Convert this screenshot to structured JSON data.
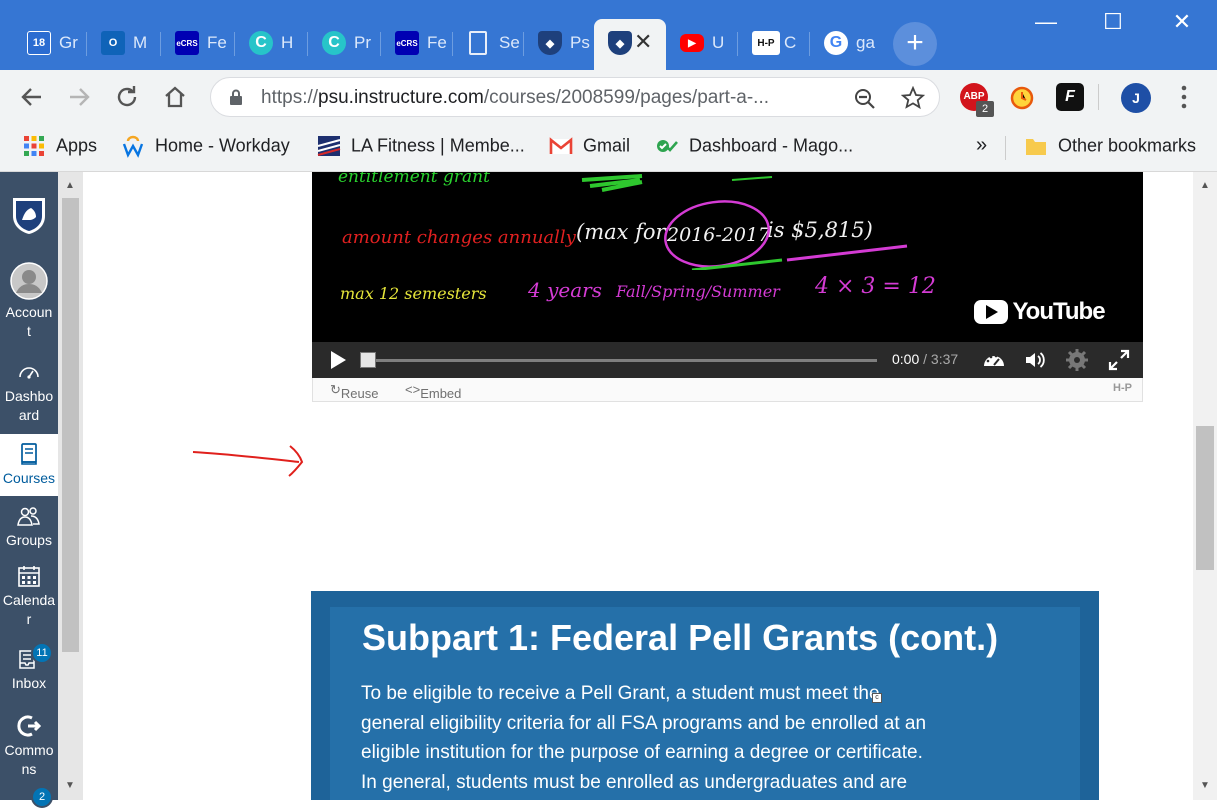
{
  "browser": {
    "tabs": [
      {
        "title": "Gr",
        "favicon": "calendar-18-icon",
        "badge": "18"
      },
      {
        "title": "M",
        "favicon": "outlook-icon"
      },
      {
        "title": "Fe",
        "favicon": "ecrs-icon",
        "badge": "eCRS"
      },
      {
        "title": "H",
        "favicon": "circle-c-icon"
      },
      {
        "title": "Pr",
        "favicon": "circle-c-icon"
      },
      {
        "title": "Fe",
        "favicon": "ecrs-icon",
        "badge": "eCRS"
      },
      {
        "title": "Se",
        "favicon": "document-icon"
      },
      {
        "title": "Ps",
        "favicon": "penn-state-shield-icon"
      },
      {
        "title": "",
        "favicon": "penn-state-shield-icon",
        "active": true
      },
      {
        "title": "U",
        "favicon": "youtube-icon"
      },
      {
        "title": "C",
        "favicon": "h5p-icon",
        "badge": "H-P"
      },
      {
        "title": "ga",
        "favicon": "google-icon"
      }
    ],
    "new_tab": "+",
    "window_controls": {
      "minimize": "—",
      "maximize": "☐",
      "close": "✕"
    },
    "url": {
      "scheme": "https://",
      "host": "psu.instructure.com",
      "path": "/courses/2008599/pages/part-a-..."
    },
    "extensions": {
      "abp_label": "ABP",
      "abp_count": "2",
      "profile_initial": "J"
    },
    "bookmarks": [
      {
        "label": "Apps",
        "icon": "apps-grid-icon"
      },
      {
        "label": "Home - Workday",
        "icon": "workday-icon"
      },
      {
        "label": "LA Fitness | Membe...",
        "icon": "la-fitness-icon"
      },
      {
        "label": "Gmail",
        "icon": "gmail-icon"
      },
      {
        "label": "Dashboard - Mago...",
        "icon": "check-icon"
      }
    ],
    "bookmarks_overflow": "»",
    "other_bookmarks": "Other bookmarks"
  },
  "canvas_nav": {
    "items": [
      {
        "label_line1": "Accoun",
        "label_line2": "t",
        "icon": "account-avatar-icon"
      },
      {
        "label_line1": "Dashbo",
        "label_line2": "ard",
        "icon": "dashboard-gauge-icon"
      },
      {
        "label_line1": "Courses",
        "label_line2": "",
        "icon": "courses-book-icon",
        "active": true
      },
      {
        "label_line1": "Groups",
        "label_line2": "",
        "icon": "groups-icon"
      },
      {
        "label_line1": "Calendar",
        "label_line2": "r",
        "icon": "calendar-icon"
      },
      {
        "label_line1": "Inbox",
        "label_line2": "",
        "icon": "inbox-icon",
        "badge": "11"
      },
      {
        "label_line1": "Commons",
        "label_line2": "ns",
        "icon": "commons-icon"
      }
    ],
    "bottom_badge": "2"
  },
  "video": {
    "lines": {
      "l1": "entitlement grant",
      "l2a": "amount changes annually",
      "l2b": "(max for",
      "l2c": "2016-2017",
      "l2d": "is $5,815)",
      "l3a": "max 12 semesters",
      "l3b": "4 years",
      "l3c": "Fall/Spring/Summer",
      "l3d": "4 × 3 = 12"
    },
    "youtube_label": "YouTube",
    "time_current": "0:00",
    "time_total": "3:37",
    "time_sep": " / ",
    "progress_fraction": 0.0,
    "reuse_label": "Reuse",
    "embed_label": "Embed",
    "h5p_label": "H-P"
  },
  "pell_section": {
    "title": "Subpart 1: Federal Pell Grants (cont.)",
    "text_lines": [
      "To be eligible to receive a Pell Grant,  a student must meet the",
      "general eligibility criteria for all FSA programs and be enrolled at an",
      "eligible institution for the purpose of earning a degree or certificate.",
      "In general, students must be enrolled as undergraduates and are"
    ]
  },
  "colors": {
    "tabstrip": "#3676d3",
    "canvas_nav": "#3c5068",
    "pell_box": "#1e6399",
    "annotation_arrow": "#e0201c"
  }
}
